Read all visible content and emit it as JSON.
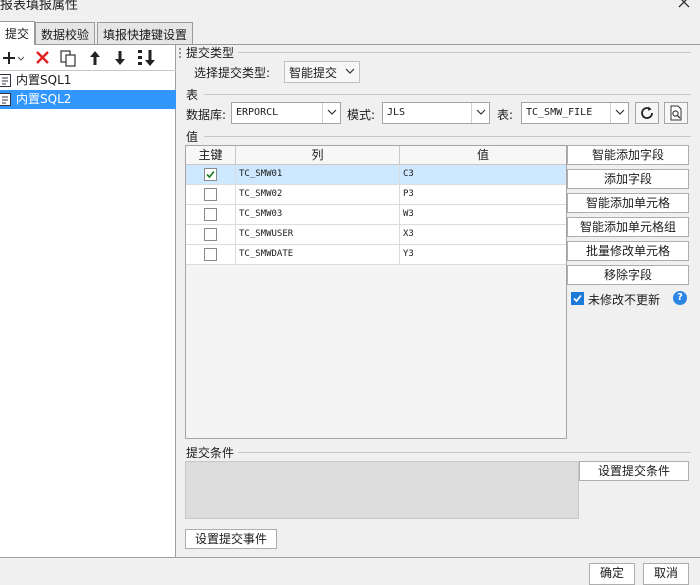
{
  "window": {
    "title": "报表填报属性"
  },
  "tabs": [
    {
      "label": "提交",
      "active": true
    },
    {
      "label": "数据校验",
      "active": false
    },
    {
      "label": "填报快捷键设置",
      "active": false
    }
  ],
  "toolbar": {
    "icons": [
      "add-dropdown-icon",
      "delete-icon",
      "copy-icon",
      "move-up-icon",
      "move-down-icon",
      "sort-icon"
    ]
  },
  "sql_list": [
    {
      "label": "内置SQL1",
      "selected": false
    },
    {
      "label": "内置SQL2",
      "selected": true
    }
  ],
  "submit_type": {
    "section": "提交类型",
    "label": "选择提交类型:",
    "value": "智能提交"
  },
  "table_section": {
    "section": "表",
    "db_label": "数据库:",
    "db_value": "ERPORCL",
    "schema_label": "模式:",
    "schema_value": "JLS",
    "table_label": "表:",
    "table_value": "TC_SMW_FILE"
  },
  "value_section": {
    "section": "值",
    "headers": {
      "key": "主键",
      "column": "列",
      "value": "值"
    },
    "rows": [
      {
        "key": true,
        "column": "TC_SMW01",
        "value": "C3",
        "selected": true
      },
      {
        "key": false,
        "column": "TC_SMW02",
        "value": "P3",
        "selected": false
      },
      {
        "key": false,
        "column": "TC_SMW03",
        "value": "W3",
        "selected": false
      },
      {
        "key": false,
        "column": "TC_SMWUSER",
        "value": "X3",
        "selected": false
      },
      {
        "key": false,
        "column": "TC_SMWDATE",
        "value": "Y3",
        "selected": false
      }
    ]
  },
  "side_buttons": {
    "smart_add_field": "智能添加字段",
    "add_field": "添加字段",
    "smart_add_cell": "智能添加单元格",
    "smart_add_cell_group": "智能添加单元格组",
    "batch_edit_cell": "批量修改单元格",
    "remove_field": "移除字段",
    "no_update_label": "未修改不更新",
    "no_update_checked": true,
    "help": "?"
  },
  "condition": {
    "section": "提交条件",
    "button": "设置提交条件"
  },
  "event_button": "设置提交事件",
  "footer": {
    "ok": "确定",
    "cancel": "取消"
  },
  "colors": {
    "selection": "#3296ff",
    "row_selected": "#cde8ff",
    "accent": "#1e7ad8",
    "delete": "#e02020"
  }
}
